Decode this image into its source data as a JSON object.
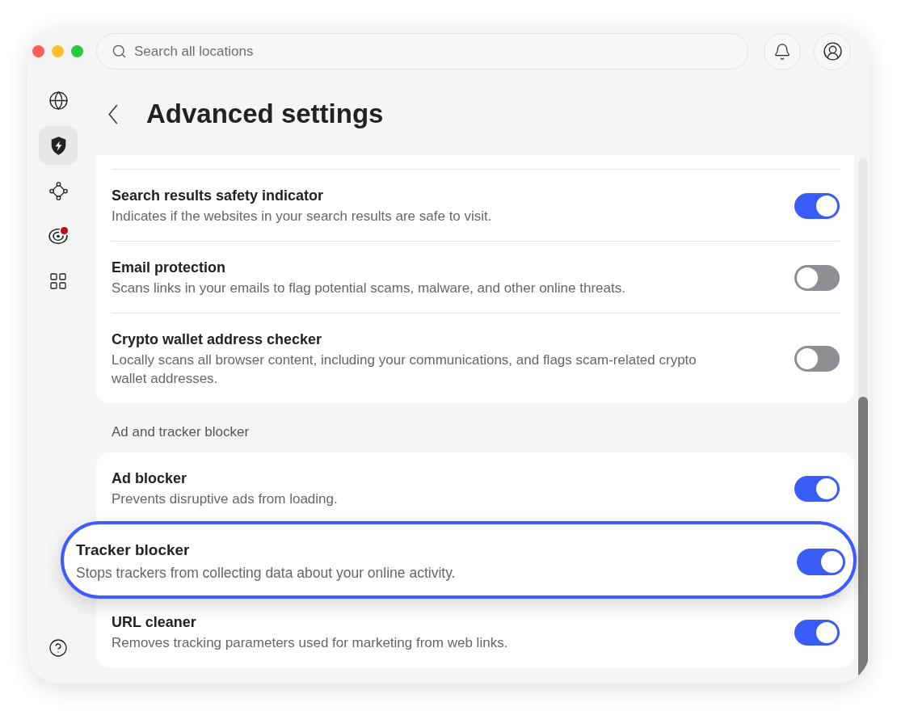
{
  "search": {
    "placeholder": "Search all locations"
  },
  "sidebar": {
    "items": [
      {
        "selected": false,
        "alert": false
      },
      {
        "selected": true,
        "alert": false
      },
      {
        "selected": false,
        "alert": false
      },
      {
        "selected": false,
        "alert": true
      },
      {
        "selected": false,
        "alert": false
      }
    ]
  },
  "header": {
    "title": "Advanced settings"
  },
  "sections": [
    {
      "rows": [
        {
          "title": "Search results safety indicator",
          "description": "Indicates if the websites in your search results are safe to visit.",
          "on": true,
          "highlighted": false
        },
        {
          "title": "Email protection",
          "description": "Scans links in your emails to flag potential scams, malware, and other online threats.",
          "on": false,
          "highlighted": false
        },
        {
          "title": "Crypto wallet address checker",
          "description": "Locally scans all browser content, including your communications, and flags scam-related crypto wallet addresses.",
          "on": false,
          "highlighted": false
        }
      ]
    },
    {
      "label": "Ad and tracker blocker",
      "rows": [
        {
          "title": "Ad blocker",
          "description": "Prevents disruptive ads from loading.",
          "on": true,
          "highlighted": false
        },
        {
          "title": "Tracker blocker",
          "description": "Stops trackers from collecting data about your online activity.",
          "on": true,
          "highlighted": true
        },
        {
          "title": "URL cleaner",
          "description": "Removes tracking parameters used for marketing from web links.",
          "on": true,
          "highlighted": false
        }
      ]
    }
  ]
}
